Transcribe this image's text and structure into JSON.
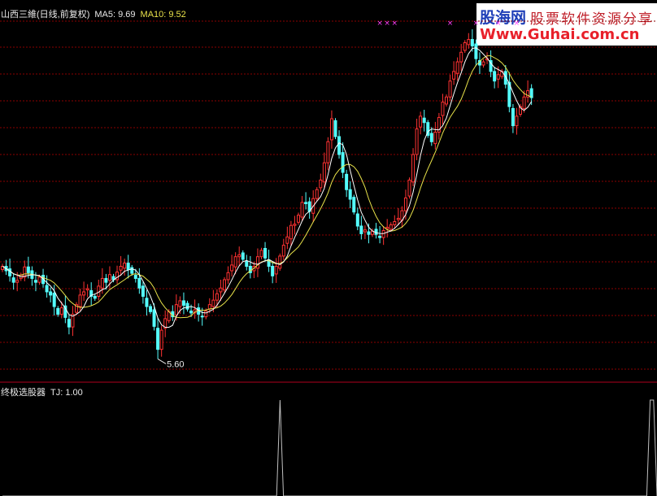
{
  "main_header": {
    "stock": "山西三維(日线,前复权)",
    "ma5_label": "MA5: 9.69",
    "ma10_label": "MA10: 9.52"
  },
  "indicator_header": {
    "name": "终极选股器",
    "value_label": "TJ: 1.00"
  },
  "logo": {
    "line1a": "股海网",
    "line1b": "股票软件资源分享",
    "line2": "Www.Guhai.com.cn"
  },
  "colors": {
    "up": "#ff3232",
    "down": "#54ffff",
    "ma5": "#ffffff",
    "ma10": "#e8e24a",
    "grid": "#8b0000",
    "signal": "#ff40ff",
    "indicator": "#c0c0c0",
    "text": "#e8e8e8"
  },
  "chart_data": {
    "type": "candlestick",
    "ylim": [
      5.3,
      10.9
    ],
    "min_label": "5.60",
    "min_label_index": 42,
    "signals": [
      {
        "index": 102,
        "label": "×"
      },
      {
        "index": 104,
        "label": "×"
      },
      {
        "index": 106,
        "label": "×"
      },
      {
        "index": 121,
        "label": "×"
      },
      {
        "index": 128,
        "label": "×"
      },
      {
        "index": 134,
        "label": "×"
      },
      {
        "index": 139,
        "label": "×"
      }
    ],
    "indicator": {
      "name": "TJ",
      "ylim": [
        0,
        1
      ],
      "values": [
        0,
        0,
        0,
        0,
        0,
        0,
        0,
        0,
        0,
        0,
        0,
        0,
        0,
        0,
        0,
        0,
        0,
        0,
        0,
        0,
        0,
        0,
        0,
        0,
        0,
        0,
        0,
        0,
        0,
        0,
        0,
        0,
        0,
        0,
        0,
        0,
        0,
        0,
        0,
        0,
        0,
        0,
        0,
        0,
        0,
        0,
        0,
        0,
        0,
        0,
        0,
        0,
        0,
        0,
        0,
        0,
        0,
        0,
        0,
        0,
        0,
        0,
        0,
        0,
        0,
        0,
        0,
        0,
        0,
        0,
        0,
        0,
        0,
        0,
        0,
        0,
        0,
        0,
        0,
        0,
        0,
        1,
        0,
        0,
        0,
        0,
        0,
        0,
        0,
        0,
        0,
        0,
        0,
        0,
        0,
        0,
        0,
        0,
        0,
        0,
        0,
        0,
        0,
        0,
        0,
        0,
        0,
        0,
        0,
        0,
        0,
        0,
        0,
        0,
        0,
        0,
        0,
        0,
        0,
        0,
        0,
        0,
        0,
        0,
        0,
        0,
        0,
        0,
        0,
        0,
        0,
        0,
        0,
        0,
        0,
        0,
        0,
        0,
        0,
        0,
        0,
        0,
        0,
        0,
        0,
        0,
        0,
        0,
        0,
        0,
        0,
        0,
        0,
        0,
        0,
        0,
        0,
        0,
        0,
        0,
        0,
        0,
        0,
        0,
        0,
        0,
        0,
        0,
        0,
        0,
        0,
        0,
        0,
        0,
        0,
        0,
        0,
        0,
        0,
        0,
        0,
        0,
        0,
        0,
        0,
        0,
        0,
        0,
        0,
        1,
        1,
        0
      ]
    },
    "close": [
      7.05,
      6.98,
      6.9,
      6.8,
      6.83,
      6.91,
      7.04,
      6.95,
      6.86,
      6.8,
      6.88,
      6.78,
      6.65,
      6.6,
      6.42,
      6.3,
      6.4,
      6.25,
      6.1,
      6.3,
      6.45,
      6.6,
      6.65,
      6.7,
      6.58,
      6.55,
      6.74,
      6.86,
      6.8,
      6.92,
      6.84,
      6.96,
      7.05,
      7.1,
      7.0,
      6.94,
      6.86,
      6.71,
      6.58,
      6.42,
      6.34,
      6.11,
      5.75,
      6.05,
      6.23,
      6.34,
      6.26,
      6.45,
      6.51,
      6.44,
      6.38,
      6.32,
      6.37,
      6.3,
      6.26,
      6.35,
      6.45,
      6.52,
      6.62,
      6.71,
      6.84,
      6.95,
      7.07,
      7.2,
      7.23,
      7.16,
      7.05,
      6.95,
      7.05,
      7.2,
      7.3,
      7.18,
      7.05,
      6.9,
      7.05,
      7.21,
      7.38,
      7.51,
      7.69,
      7.71,
      7.85,
      8.05,
      8.03,
      7.91,
      8.11,
      8.25,
      8.4,
      8.67,
      9.0,
      9.36,
      9.08,
      8.8,
      8.52,
      8.25,
      8.1,
      7.9,
      7.68,
      7.56,
      7.62,
      7.55,
      7.6,
      7.55,
      7.5,
      7.61,
      7.66,
      7.7,
      7.75,
      7.8,
      7.92,
      8.12,
      8.4,
      8.8,
      9.2,
      9.4,
      9.3,
      9.1,
      9.0,
      9.15,
      9.38,
      9.62,
      9.7,
      9.95,
      10.1,
      10.25,
      10.4,
      10.55,
      10.6,
      10.5,
      10.3,
      10.2,
      10.25,
      10.3,
      10.1,
      9.95,
      10.05,
      10.1,
      9.9,
      9.55,
      9.25,
      9.4,
      9.55,
      9.7,
      9.8,
      9.69
    ]
  }
}
